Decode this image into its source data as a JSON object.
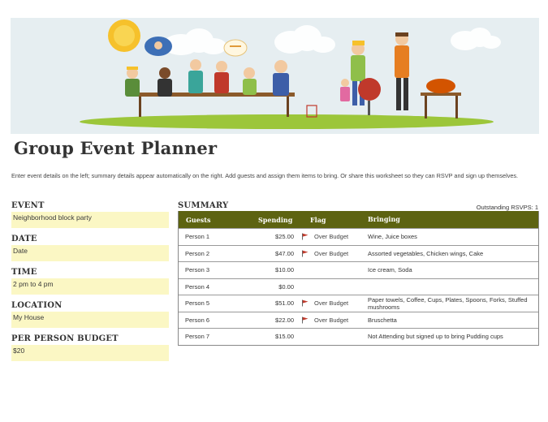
{
  "title": "Group Event Planner",
  "intro": "Enter event details on the left; summary details appear automatically on the right. Add guests and assign them items to bring. Or share this worksheet so they can RSVP and sign up themselves.",
  "event_details": [
    {
      "label": "EVENT",
      "value": "Neighborhood block party"
    },
    {
      "label": "DATE",
      "value": "Date"
    },
    {
      "label": "TIME",
      "value": "2 pm to 4 pm"
    },
    {
      "label": "LOCATION",
      "value": "My House"
    },
    {
      "label": "PER PERSON BUDGET",
      "value": "$20"
    }
  ],
  "summary": {
    "title": "SUMMARY",
    "outstanding_rsvps": "Outstanding RSVPS: 1",
    "columns": [
      "Guests",
      "Spending",
      "Flag",
      "Bringing"
    ],
    "rows": [
      {
        "guest": "Person 1",
        "spending": "$25.00",
        "flag": "Over Budget",
        "bringing": "Wine, Juice boxes"
      },
      {
        "guest": "Person 2",
        "spending": "$47.00",
        "flag": "Over Budget",
        "bringing": "Assorted vegetables, Chicken wings, Cake"
      },
      {
        "guest": "Person 3",
        "spending": "$10.00",
        "flag": "",
        "bringing": "Ice cream, Soda"
      },
      {
        "guest": "Person 4",
        "spending": "$0.00",
        "flag": "",
        "bringing": ""
      },
      {
        "guest": "Person 5",
        "spending": "$51.00",
        "flag": "Over Budget",
        "bringing": "Paper towels, Coffee, Cups, Plates, Spoons, Forks, Stuffed mushrooms"
      },
      {
        "guest": "Person 6",
        "spending": "$22.00",
        "flag": "Over Budget",
        "bringing": "Bruschetta"
      },
      {
        "guest": "Person 7",
        "spending": "$15.00",
        "flag": "",
        "bringing": "Not Attending but signed up to bring Pudding cups"
      }
    ]
  },
  "colors": {
    "header_bg": "#5d6311",
    "input_bg": "#fbf7c4",
    "flag_red": "#c0392b",
    "banner_bg": "#e6eef1"
  },
  "icons": {
    "flag": "red-flag-icon"
  }
}
